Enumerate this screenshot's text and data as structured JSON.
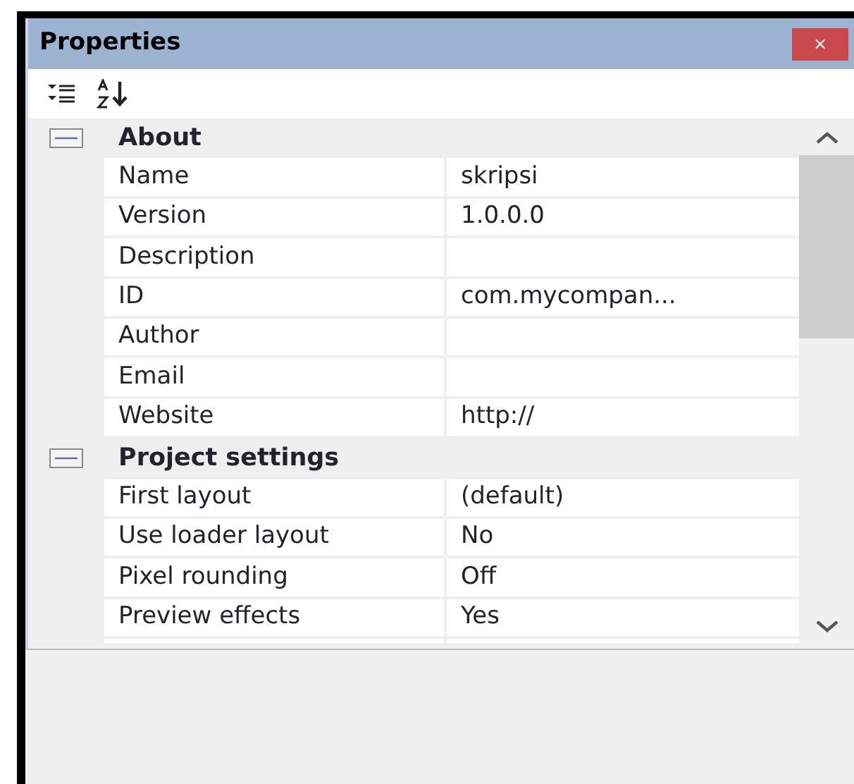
{
  "window": {
    "title": "Properties",
    "close": "×"
  },
  "categories": [
    {
      "title": "About",
      "expanded": true,
      "properties": [
        {
          "name": "Name",
          "value": "skripsi"
        },
        {
          "name": "Version",
          "value": "1.0.0.0"
        },
        {
          "name": "Description"
        },
        {
          "name": "ID",
          "value": "com.mycompan..."
        },
        {
          "name": "Author"
        },
        {
          "name": "Email"
        },
        {
          "name": "Website",
          "value": "http://"
        }
      ]
    },
    {
      "title": "Project settings",
      "expanded": true,
      "properties": [
        {
          "name": "First layout",
          "value": "(default)"
        },
        {
          "name": "Use loader layout",
          "value": "No"
        },
        {
          "name": "Pixel rounding",
          "value": "Off"
        },
        {
          "name": "Preview effects",
          "value": "Yes"
        }
      ]
    }
  ]
}
